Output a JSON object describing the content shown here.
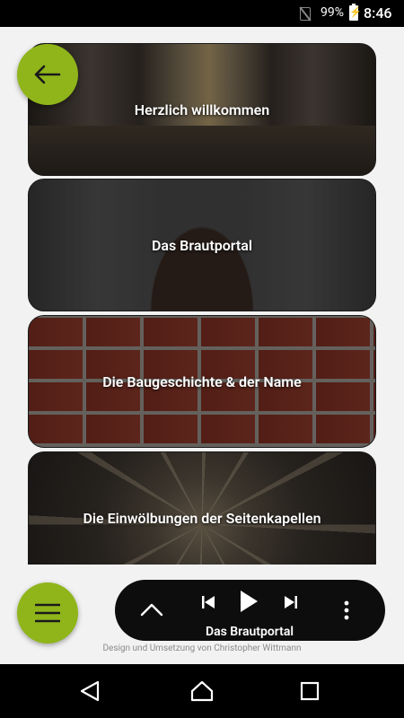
{
  "status_bar": {
    "battery": "99%",
    "time": "8:46"
  },
  "sections": [
    {
      "title": "Herzlich willkommen"
    },
    {
      "title": "Das Brautportal"
    },
    {
      "title": "Die Baugeschichte & der Name"
    },
    {
      "title": "Die Einwölbungen der Seitenkapellen"
    }
  ],
  "player": {
    "now_playing": "Das Brautportal"
  },
  "footer": {
    "credit": "Design und Umsetzung von Christopher Wittmann"
  },
  "colors": {
    "accent": "#8fb51a",
    "player_bg": "#0d0d0d"
  }
}
